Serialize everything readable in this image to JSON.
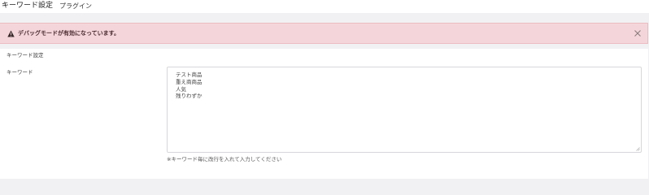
{
  "header": {
    "title": "キーワード設定",
    "subtitle": "プラグイン"
  },
  "alert": {
    "message": "デバッグモードが有効になっています。",
    "icon": "warning-icon",
    "close_icon": "close-icon",
    "background_color": "#f4d6da"
  },
  "form": {
    "section_heading": "キーワード設定",
    "keyword_label": "キーワード",
    "keyword_lines": [
      "テスト商品",
      "重え商商品",
      "人気",
      "残りわずか"
    ],
    "help_text": "※キーワード毎に改行を入れて入力してください"
  }
}
